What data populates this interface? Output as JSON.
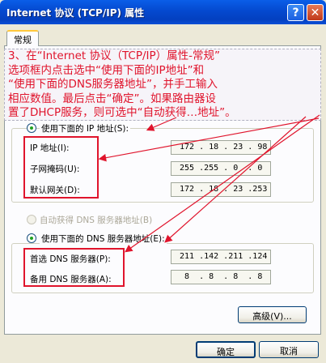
{
  "window": {
    "title": "Internet 协议 (TCP/IP) 属性",
    "help_glyph": "?",
    "close_glyph": "✕"
  },
  "tab": {
    "label": "常规"
  },
  "annotation": {
    "lines": [
      "3、在“Internet 协议（TCP/IP）属性-常规”",
      "选项框内点击选中“使用下面的IP地址”和",
      "“使用下面的DNS服务器地址”，并手工输入",
      "相应数值。最后点击“确定”。如果路由器设",
      "置了DHCP服务，则可选中“自动获得…地址”。"
    ],
    "color": "#e0142c"
  },
  "ip_section": {
    "radio_label": "使用下面的 IP 地址(S):",
    "selected": true,
    "fields": [
      {
        "label": "IP 地址(I):",
        "value": "172 . 18 . 23 . 98"
      },
      {
        "label": "子网掩码(U):",
        "value": "255 .255 . 0  . 0"
      },
      {
        "label": "默认网关(D):",
        "value": "172 . 18 . 23 .253"
      }
    ]
  },
  "dns_auto": {
    "label": "自动获得 DNS 服务器地址(B)",
    "enabled": false
  },
  "dns_section": {
    "radio_label": "使用下面的 DNS 服务器地址(E):",
    "selected": true,
    "fields": [
      {
        "label": "首选 DNS 服务器(P):",
        "value": "211 .142 .211 .124"
      },
      {
        "label": "备用 DNS 服务器(A):",
        "value": " 8  . 8  . 8  . 8"
      }
    ]
  },
  "buttons": {
    "advanced": "高级(V)...",
    "ok": "确定",
    "cancel": "取消"
  },
  "colors": {
    "title_bar": "#0449cf",
    "highlight": "#e0142c",
    "dialog_bg": "#ece9d8"
  }
}
